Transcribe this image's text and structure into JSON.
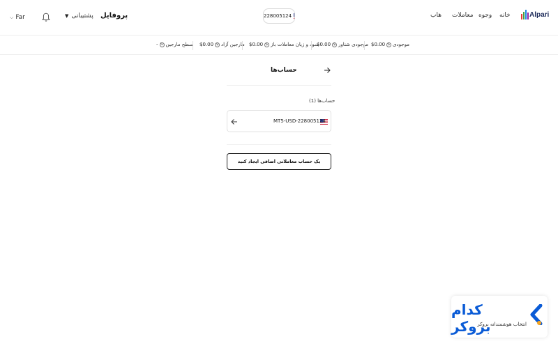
{
  "header": {
    "language": "Far",
    "support": "پشتیبانی",
    "profile": "پروفایل",
    "account_pill": "228005124",
    "menu": [
      "هاب",
      "معاملات",
      "وجوه",
      "خانه"
    ],
    "logo_text": "Alpari"
  },
  "stats": {
    "balance": {
      "label": "موجودی",
      "value": "$0.00"
    },
    "floating_balance": {
      "label": "موجودی شناور",
      "value": "$0.00"
    },
    "open_pnl": {
      "label": "سود و زیان معاملات باز",
      "value": "$0.00"
    },
    "free_margin": {
      "label": "مارجین آزاد",
      "value": "$0.00"
    },
    "margin_level": {
      "label": "سطح مارجین",
      "value": "-"
    }
  },
  "main": {
    "title": "حساب‌ها",
    "section_label": "حساب‌ها (1)",
    "account_id": "MT5-USD-228005124",
    "create_button": "یک حساب معاملاتی اضافی ایجاد کنید"
  },
  "watermark": {
    "title": "کدام بروکر",
    "subtitle": "انتخاب هوشمندانه بروکر"
  },
  "colors": {
    "brand_blue": "#0a5bd6",
    "flag_red": "#c8102e",
    "flag_blue": "#2a3b8f",
    "text": "#1a1a1a"
  },
  "icons": [
    "chevron-down-icon",
    "bell-icon",
    "us-flag-icon",
    "alpari-logo-icon",
    "dollar-coin-icon",
    "arrow-right-icon",
    "arrow-left-icon",
    "kodam-broker-logo-icon"
  ]
}
